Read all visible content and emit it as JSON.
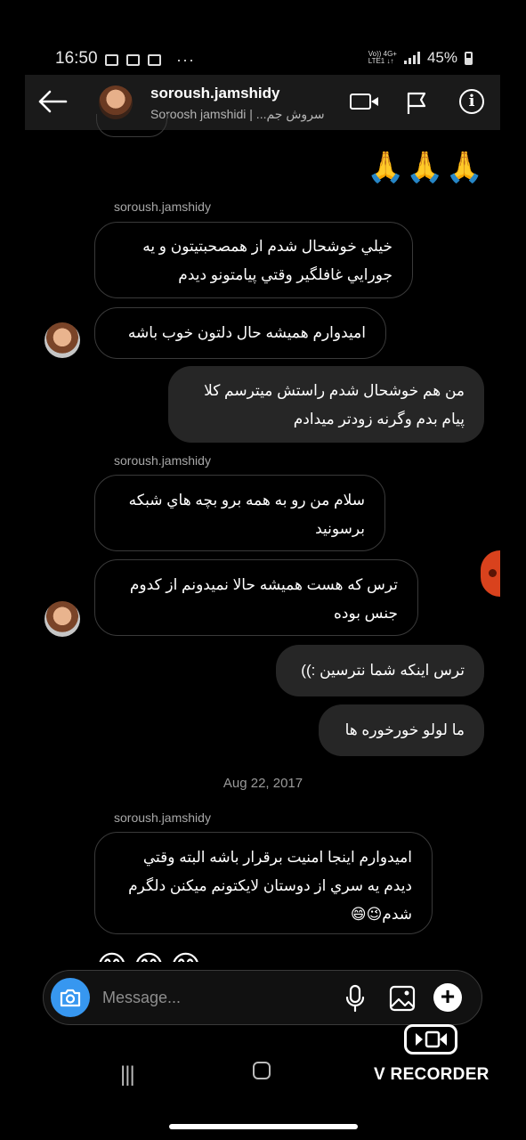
{
  "status_bar": {
    "time": "16:50",
    "dots": "···",
    "net_top": "Vo)) 4G+",
    "net_bottom": "LTE1 ↓↑",
    "battery": "45%"
  },
  "header": {
    "username": "soroush.jamshidy",
    "subtitle": "Soroosh jamshidi | ...سروش جم"
  },
  "chat": {
    "reactions": "🙏🙏🙏",
    "groups": [
      {
        "sender": "soroush.jamshidy"
      },
      {
        "sender": "soroush.jamshidy"
      },
      {
        "sender": "soroush.jamshidy"
      }
    ],
    "messages": [
      {
        "dir": "in",
        "text": "خيلي خوشحال شدم از همصحبتيتون و يه\nجورايي غافلگير وقتي پيامتونو ديدم"
      },
      {
        "dir": "in",
        "text": "اميدوارم هميشه حال دلتون خوب باشه"
      },
      {
        "dir": "out",
        "text": "من هم خوشحال شدم راستش ميترسم کلا\nپيام بدم وگرنه زودتر ميدادم"
      },
      {
        "dir": "in",
        "text": "سلام من رو به همه برو بچه هاي شبكه\nبرسونيد"
      },
      {
        "dir": "in",
        "text": "ترس كه هست هميشه حالا نميدونم از كدوم\nجنس بوده"
      },
      {
        "dir": "out",
        "text": "ترس اينكه شما نترسين :))"
      },
      {
        "dir": "out",
        "text": "ما لولو خورخوره ها"
      },
      {
        "dir": "in",
        "text": "اميدوارم اينجا امنيت برقرار باشه البته وقتي\nديدم يه سري از دوستان لايكتونم ميكنن دلگرم\nشدم😉😄"
      }
    ],
    "date_separator": "Aug 22, 2017",
    "partial_emojis": "😄😄😄"
  },
  "input": {
    "placeholder": "Message..."
  },
  "watermark": {
    "label": "V RECORDER"
  },
  "colors": {
    "background": "#000000",
    "incoming_border": "#3a3a3a",
    "outgoing_bubble": "#262626",
    "camera_button": "#3797f0"
  },
  "icons": [
    "back-arrow-icon",
    "video-call-icon",
    "flag-icon",
    "info-icon",
    "camera-icon",
    "microphone-icon",
    "gallery-icon",
    "plus-icon"
  ]
}
